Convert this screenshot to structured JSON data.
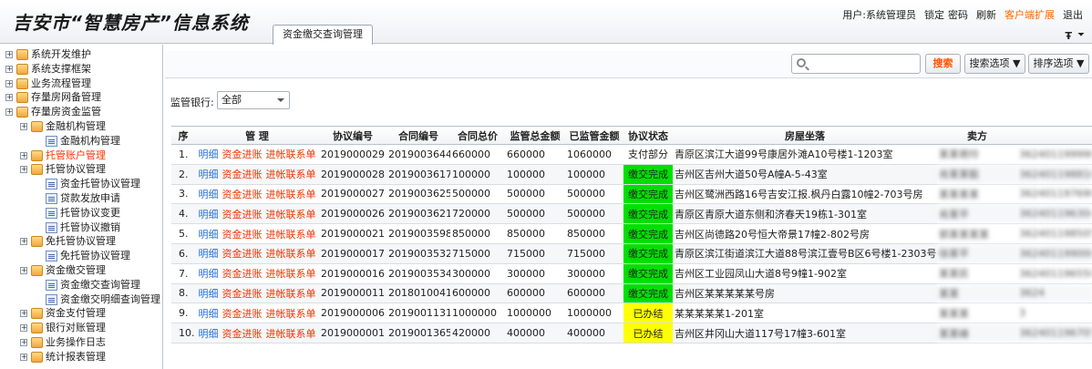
{
  "header": {
    "title": "吉安市“智慧房产”信息系统",
    "user": "用户:系统管理员",
    "lock": "锁定",
    "password": "密码",
    "refresh": "刷新",
    "client_ext": "客户端扩展",
    "logout": "退出",
    "tab": "资金缴交查询管理"
  },
  "sidebar": {
    "items": [
      {
        "label": "系统开发维护",
        "level": 0,
        "type": "folder",
        "active": false
      },
      {
        "label": "系统支撑框架",
        "level": 0,
        "type": "folder",
        "active": false
      },
      {
        "label": "业务流程管理",
        "level": 0,
        "type": "folder",
        "active": false
      },
      {
        "label": "存量房网备管理",
        "level": 0,
        "type": "folder",
        "active": false
      },
      {
        "label": "存量房资金监管",
        "level": 0,
        "type": "folder",
        "active": false
      },
      {
        "label": "金融机构管理",
        "level": 1,
        "type": "folder",
        "active": false
      },
      {
        "label": "金融机构管理",
        "level": 2,
        "type": "page",
        "active": false
      },
      {
        "label": "托管账户管理",
        "level": 1,
        "type": "folder",
        "active": true
      },
      {
        "label": "托管协议管理",
        "level": 1,
        "type": "folder",
        "active": false
      },
      {
        "label": "资金托管协议管理",
        "level": 2,
        "type": "page",
        "active": false
      },
      {
        "label": "贷款发放申请",
        "level": 2,
        "type": "page",
        "active": false
      },
      {
        "label": "托管协议变更",
        "level": 2,
        "type": "page",
        "active": false
      },
      {
        "label": "托管协议撤销",
        "level": 2,
        "type": "page",
        "active": false
      },
      {
        "label": "免托管协议管理",
        "level": 1,
        "type": "folder",
        "active": false
      },
      {
        "label": "免托管协议管理",
        "level": 2,
        "type": "page",
        "active": false
      },
      {
        "label": "资金缴交管理",
        "level": 1,
        "type": "folder",
        "active": false
      },
      {
        "label": "资金缴交查询管理",
        "level": 2,
        "type": "page",
        "active": false
      },
      {
        "label": "资金缴交明细查询管理",
        "level": 2,
        "type": "page",
        "active": false
      },
      {
        "label": "资金支付管理",
        "level": 1,
        "type": "folder",
        "active": false
      },
      {
        "label": "银行对账管理",
        "level": 1,
        "type": "folder",
        "active": false
      },
      {
        "label": "业务操作日志",
        "level": 1,
        "type": "folder",
        "active": false
      },
      {
        "label": "统计报表管理",
        "level": 1,
        "type": "folder",
        "active": false
      }
    ]
  },
  "toolbar": {
    "search_placeholder": "",
    "search_label": "搜索",
    "search_options": "搜索选项 ▼",
    "sort_options": "排序选项 ▼"
  },
  "filter": {
    "label": "监管银行:",
    "selected": "全部"
  },
  "table": {
    "columns": [
      "序",
      "管 理",
      "协议编号",
      "合同编号",
      "合同总价",
      "监管总金额",
      "已监管金额",
      "协议状态",
      "房屋坐落",
      "卖方",
      ""
    ],
    "actions": {
      "detail": "明细",
      "deposit": "资金进账",
      "contact": "进帐联系单"
    },
    "rows": [
      {
        "seq": "1.",
        "agreement": "2019000029",
        "contract": "2019003644",
        "total": "660000",
        "supervised_total": "660000",
        "supervised": "1060000",
        "status": "支付部分",
        "status_color": "none",
        "address": "青原区滨江大道99号康居外滩A10号楼1-1203室",
        "seller": "某某艳玲",
        "id_no": "362401199990021"
      },
      {
        "seq": "2.",
        "agreement": "2019000028",
        "contract": "2019003617",
        "total": "100000",
        "supervised_total": "100000",
        "supervised": "100000",
        "status": "缴交完成",
        "status_color": "green",
        "address": "吉州区吉州大道50号A幢A-5-43室",
        "seller": "肖某某毅",
        "id_no": "362401198810900"
      },
      {
        "seq": "3.",
        "agreement": "2019000027",
        "contract": "2019003625",
        "total": "500000",
        "supervised_total": "500000",
        "supervised": "500000",
        "status": "缴交完成",
        "status_color": "green",
        "address": "吉州区鹭洲西路16号吉安江报.枫丹白露10幢2-703号房",
        "seller": "某某某某",
        "id_no": "362401197690021"
      },
      {
        "seq": "4.",
        "agreement": "2019000026",
        "contract": "2019003621",
        "total": "720000",
        "supervised_total": "500000",
        "supervised": "500000",
        "status": "缴交完成",
        "status_color": "green",
        "address": "青原区青原大道东侧和济春天19栋1-301室",
        "seller": "肖某平",
        "id_no": "362401196304219"
      },
      {
        "seq": "5.",
        "agreement": "2019000021",
        "contract": "2019003598",
        "total": "850000",
        "supervised_total": "850000",
        "supervised": "850000",
        "status": "缴交完成",
        "status_color": "green",
        "address": "吉州区尚德路20号恒大帝景17幢2-802号房",
        "seller": "郭某某某某",
        "id_no": "362401198505200"
      },
      {
        "seq": "6.",
        "agreement": "2019000017",
        "contract": "2019003532",
        "total": "715000",
        "supervised_total": "715000",
        "supervised": "715000",
        "status": "缴交完成",
        "status_color": "green",
        "address": "青原区滨江街道滨江大道88号滨江壹号B区6号楼1-2303号房",
        "seller": "徐某平",
        "id_no": "362401199000911"
      },
      {
        "seq": "7.",
        "agreement": "2019000016",
        "contract": "2019003534",
        "total": "300000",
        "supervised_total": "300000",
        "supervised": "300000",
        "status": "缴交完成",
        "status_color": "green",
        "address": "吉州区工业园凤山大道8号9幢1-902室",
        "seller": "某某民",
        "id_no": "362401196550110"
      },
      {
        "seq": "8.",
        "agreement": "2019000011",
        "contract": "2018010041",
        "total": "600000",
        "supervised_total": "600000",
        "supervised": "600000",
        "status": "缴交完成",
        "status_color": "green",
        "address": "吉州区某某某某某号房",
        "seller": "某某",
        "id_no": "3624"
      },
      {
        "seq": "9.",
        "agreement": "2019000006",
        "contract": "2019001131",
        "total": "1000000",
        "supervised_total": "1000000",
        "supervised": "1000000",
        "status": "已办结",
        "status_color": "yellow",
        "address": "某某某某某1-201室",
        "seller": "某某某",
        "id_no": "3"
      },
      {
        "seq": "10.",
        "agreement": "2019000001",
        "contract": "2019001365",
        "total": "420000",
        "supervised_total": "400000",
        "supervised": "400000",
        "status": "已办结",
        "status_color": "yellow",
        "address": "吉州区井冈山大道117号17幢3-601室",
        "seller": "某某峰",
        "id_no": "362401196705110"
      }
    ]
  }
}
